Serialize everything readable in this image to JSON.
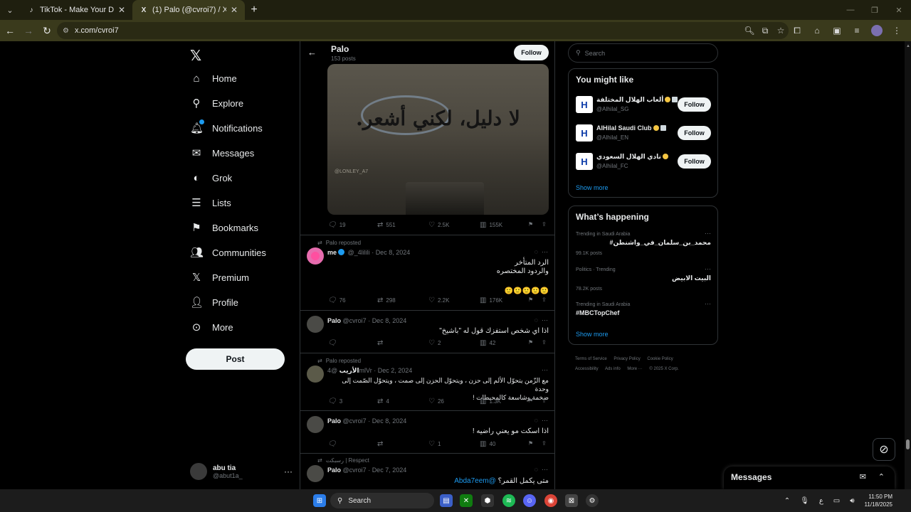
{
  "browser": {
    "tabs": [
      {
        "title": "TikTok - Make Your Day",
        "active": false
      },
      {
        "title": "(1) Palo (@cvroi7) / X",
        "active": true
      }
    ],
    "url": "x.com/cvroi7"
  },
  "nav": {
    "items": [
      {
        "label": "Home",
        "icon": "home-icon"
      },
      {
        "label": "Explore",
        "icon": "search-icon"
      },
      {
        "label": "Notifications",
        "icon": "bell-icon"
      },
      {
        "label": "Messages",
        "icon": "mail-icon"
      },
      {
        "label": "Grok",
        "icon": "grok-icon"
      },
      {
        "label": "Lists",
        "icon": "list-icon"
      },
      {
        "label": "Bookmarks",
        "icon": "bookmark-icon"
      },
      {
        "label": "Communities",
        "icon": "people-icon"
      },
      {
        "label": "Premium",
        "icon": "x-icon"
      },
      {
        "label": "Profile",
        "icon": "person-icon"
      },
      {
        "label": "More",
        "icon": "more-circle-icon"
      }
    ],
    "post_label": "Post",
    "account": {
      "name": "abu tia",
      "handle": "@abut1a_"
    }
  },
  "profile_header": {
    "name": "Palo",
    "posts": "153 posts",
    "follow_label": "Follow"
  },
  "media_post": {
    "image_text": "لا دليل، لكني أشعر.",
    "watermark": "@LONLEY_A7",
    "stats": {
      "replies": "19",
      "reposts": "551",
      "likes": "2.5K",
      "views": "155K"
    }
  },
  "tweets": [
    {
      "repost_label": "Palo reposted",
      "name": "me",
      "handle": "@_4lilili",
      "date": "Dec 8, 2024",
      "lines": [
        "الرد المتأخر",
        "والردود المختصره",
        "🙂🙂🙂🙂🙂"
      ],
      "stats": {
        "replies": "76",
        "reposts": "298",
        "likes": "2.2K",
        "views": "176K"
      }
    },
    {
      "repost_label": "",
      "name": "Palo",
      "handle": "@cvroi7",
      "date": "Dec 8, 2024",
      "lines": [
        "اذا اي شخص استفزك قول له \"باشيخ\""
      ],
      "stats": {
        "replies": "",
        "reposts": "",
        "likes": "2",
        "views": "42"
      }
    },
    {
      "repost_label": "Palo reposted",
      "name": "الأريب",
      "handle": "@4mlVr",
      "date": "Dec 2, 2024",
      "lines": [
        "مع الزّمن يتحوّل الألم إلى حزن ، ويتحوّل الحزن إلى صمت ، ويتحوّل الصّمت إلى وحدة",
        "ضخمة وشاسعة كالمحيطات !"
      ],
      "stats": {
        "replies": "3",
        "reposts": "4",
        "likes": "26",
        "views": "1.3K"
      }
    },
    {
      "repost_label": "",
      "name": "Palo",
      "handle": "@cvroi7",
      "date": "Dec 8, 2024",
      "lines": [
        "اذا اسكت مو يعني راضيه !"
      ],
      "stats": {
        "replies": "",
        "reposts": "",
        "likes": "1",
        "views": "40"
      }
    },
    {
      "repost_label": "رسبكت | Respect",
      "name": "Palo",
      "handle": "@cvroi7",
      "date": "Dec 7, 2024",
      "mention": "@Abda7eem",
      "lines": [
        "متى يكمل القمر؟"
      ],
      "stats": {}
    }
  ],
  "right": {
    "search_placeholder": "Search",
    "wtf_title": "You might like",
    "wtf": [
      {
        "name": "ألعاب الهلال المختلفة",
        "handle": "@Alhilal_SG",
        "follow": "Follow"
      },
      {
        "name": "AlHilal Saudi Club",
        "handle": "@Alhilal_EN",
        "follow": "Follow"
      },
      {
        "name": "نادي الهلال السعودي",
        "handle": "@Alhilal_FC",
        "follow": "Follow"
      }
    ],
    "show_more": "Show more",
    "happening_title": "What’s happening",
    "trends": [
      {
        "context": "Trending in Saudi Arabia",
        "title": "#محمد_بن_سلمان_في_واشنطن",
        "count": "99.1K posts"
      },
      {
        "context": "Politics · Trending",
        "title": "البيت الابيض",
        "count": "78.2K posts"
      },
      {
        "context": "Trending in Saudi Arabia",
        "title": "#MBCTopChef",
        "count": ""
      }
    ],
    "footer": [
      "Terms of Service",
      "Privacy Policy",
      "Cookie Policy",
      "Accessibility",
      "Ads info",
      "More ···",
      "© 2025 X Corp."
    ]
  },
  "messages_drawer": {
    "title": "Messages"
  },
  "taskbar": {
    "search": "Search",
    "time": "11:50 PM",
    "date": "11/18/2025",
    "lang": "ع"
  }
}
